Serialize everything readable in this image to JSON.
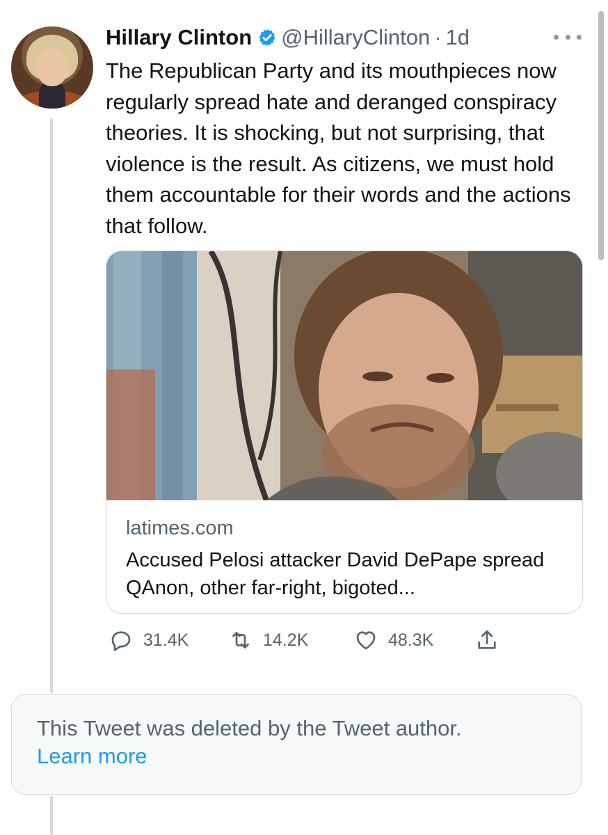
{
  "tweet": {
    "author_name": "Hillary Clinton",
    "handle": "@HillaryClinton",
    "separator": "·",
    "time": "1d",
    "text": "The Republican Party and its mouthpieces now regularly spread hate and deranged conspiracy theories. It is shocking, but not surprising, that violence is the result. As citizens, we must hold them accountable for their words and the actions that follow.",
    "verified_color": "#1d9bf0"
  },
  "card": {
    "domain": "latimes.com",
    "title": "Accused Pelosi attacker David DePape spread QAnon, other far-right, bigoted..."
  },
  "actions": {
    "reply_count": "31.4K",
    "retweet_count": "14.2K",
    "like_count": "48.3K"
  },
  "deleted_notice": {
    "text": "This Tweet was deleted by the Tweet author.",
    "link": "Learn more"
  },
  "colors": {
    "accent": "#1d9bf0",
    "secondary_text": "#536471",
    "border": "#cfd9de"
  },
  "icons": [
    "verified-badge-icon",
    "more-icon",
    "reply-icon",
    "retweet-icon",
    "like-icon",
    "share-icon"
  ]
}
